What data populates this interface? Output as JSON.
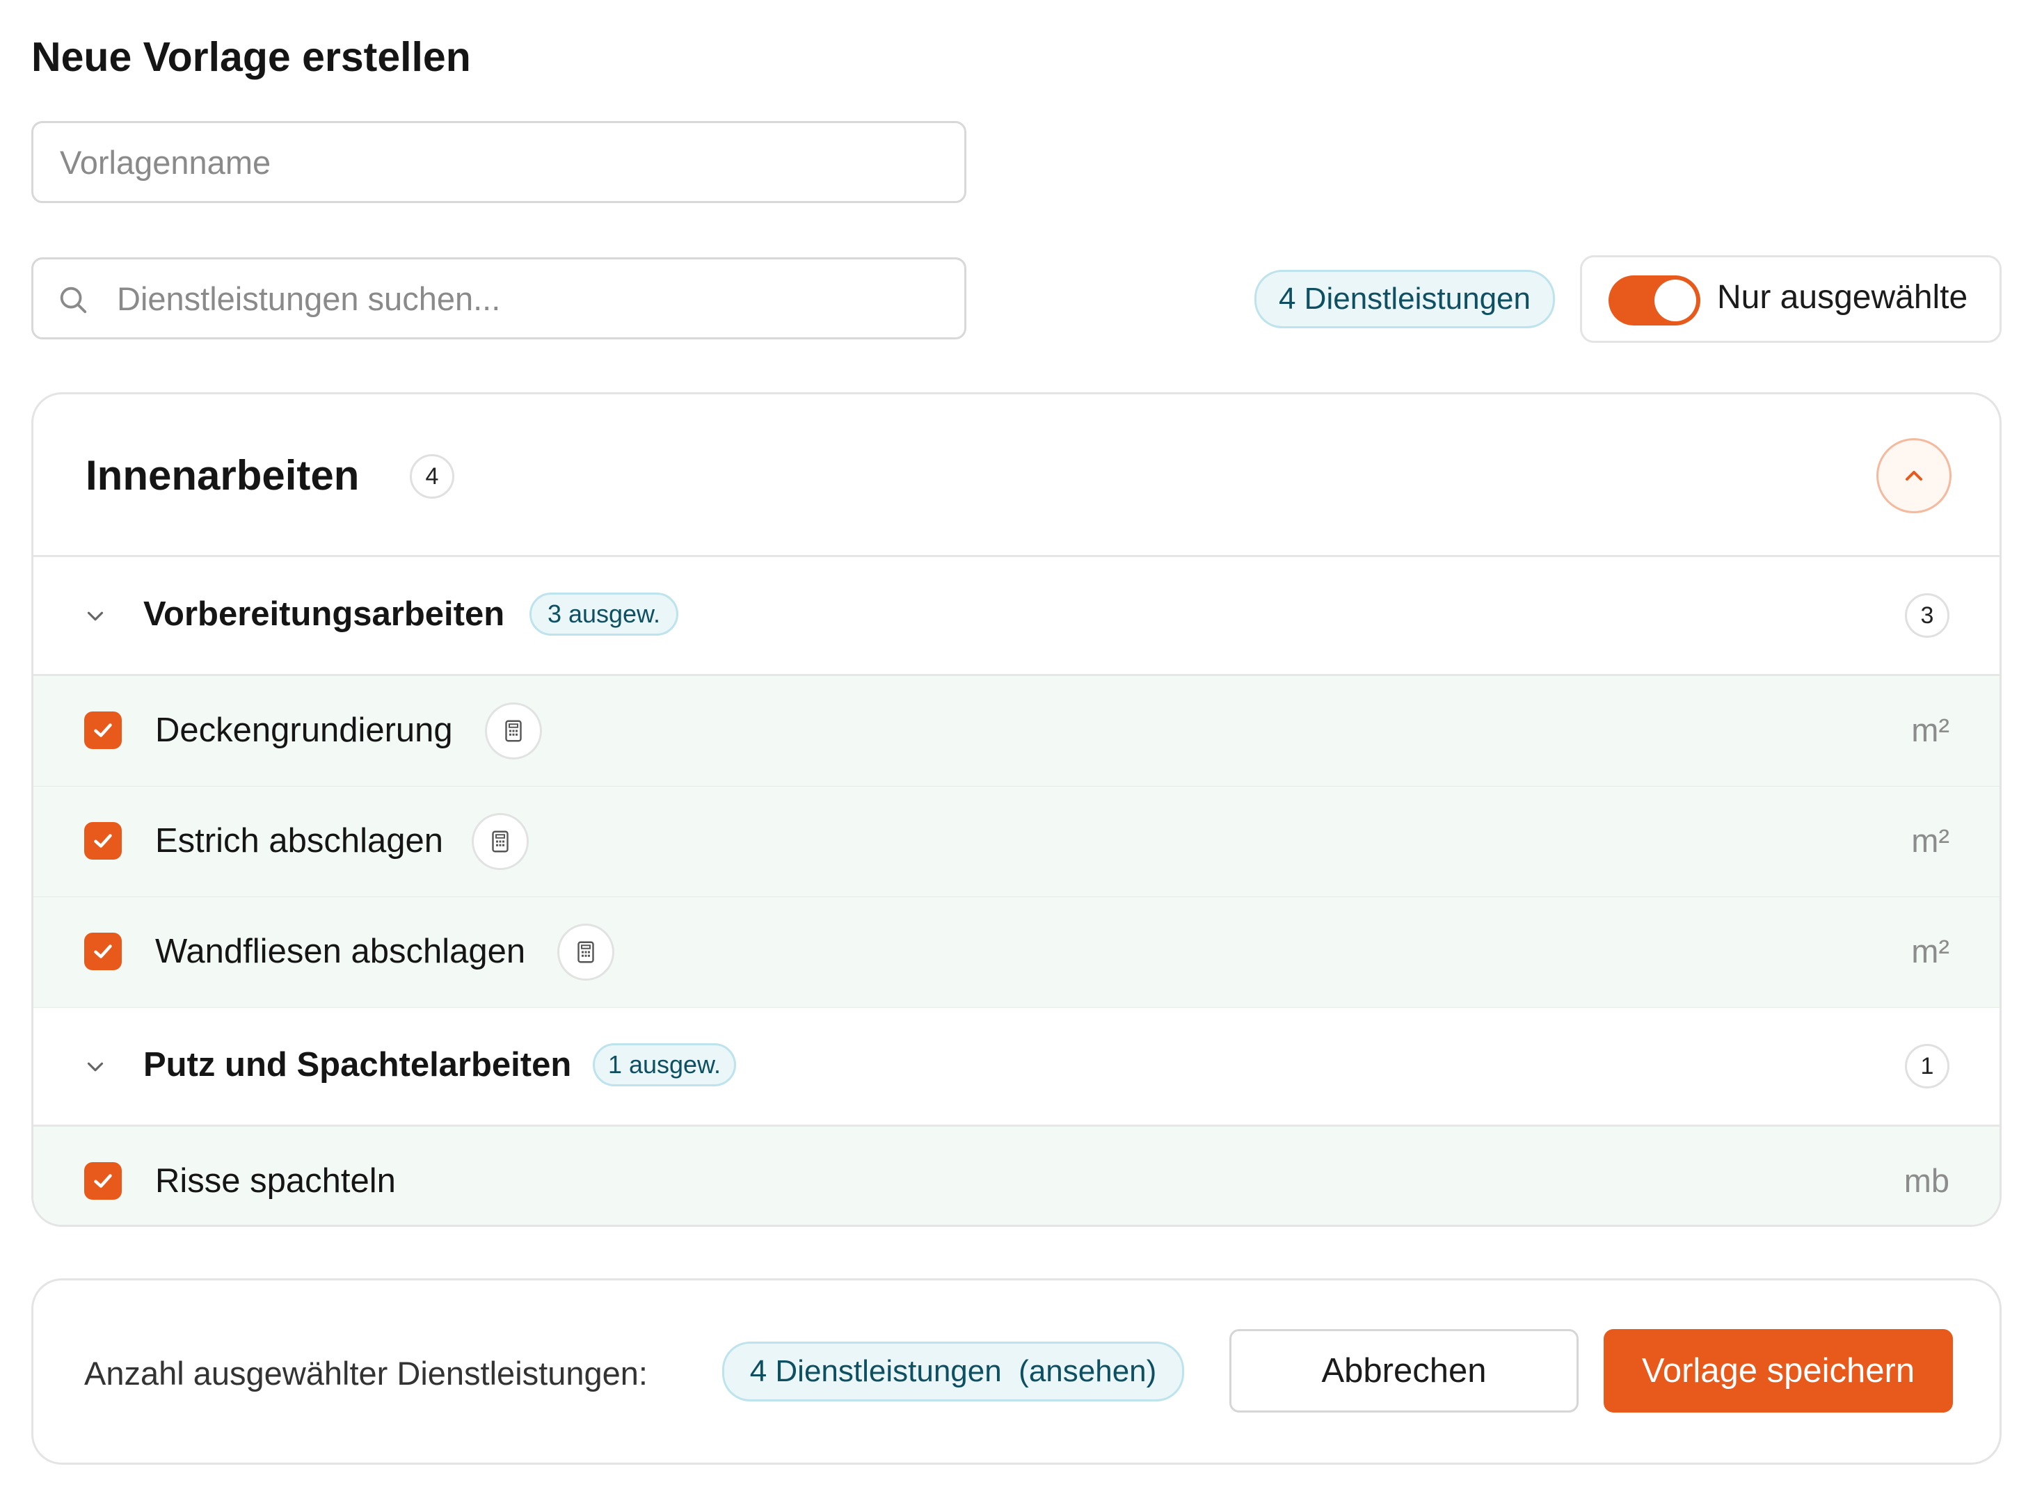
{
  "colors": {
    "accent": "#e85a1c",
    "pill_bg": "#eaf6f8",
    "pill_text": "#0e4f61",
    "selected_row_bg": "#f3faf5"
  },
  "header": {
    "title": "Neue Vorlage erstellen"
  },
  "name_field": {
    "placeholder": "Vorlagenname",
    "value": ""
  },
  "search": {
    "placeholder": "Dienstleistungen suchen...",
    "value": ""
  },
  "services_count_label": "4 Dienstleistungen",
  "filter_toggle": {
    "label": "Nur ausgewählte",
    "on": true
  },
  "category": {
    "title": "Innenarbeiten",
    "count": "4",
    "expanded": true,
    "groups": [
      {
        "label": "Vorbereitungsarbeiten",
        "selected_badge": "3 ausgew.",
        "count": "3",
        "items": [
          {
            "label": "Deckengrundierung",
            "unit": "m²",
            "checked": true,
            "has_calculator": true
          },
          {
            "label": "Estrich abschlagen",
            "unit": "m²",
            "checked": true,
            "has_calculator": true
          },
          {
            "label": "Wandfliesen abschlagen",
            "unit": "m²",
            "checked": true,
            "has_calculator": true
          }
        ]
      },
      {
        "label": "Putz und Spachtelarbeiten",
        "selected_badge": "1 ausgew.",
        "count": "1",
        "items": [
          {
            "label": "Risse spachteln",
            "unit": "mb",
            "checked": true,
            "has_calculator": false
          }
        ]
      }
    ]
  },
  "footer": {
    "label": "Anzahl ausgewählter Dienstleistungen:",
    "selected_pill": "4 Dienstleistungen  (ansehen)",
    "cancel_label": "Abbrechen",
    "save_label": "Vorlage speichern"
  }
}
